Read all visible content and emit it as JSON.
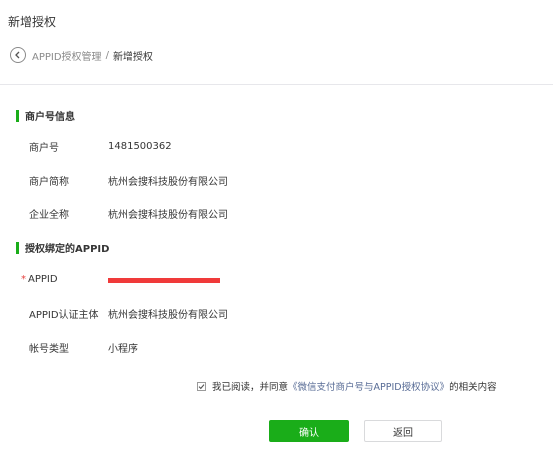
{
  "page": {
    "title": "新增授权"
  },
  "breadcrumb": {
    "back_icon": "chevron-left-icon",
    "parent": "APPID授权管理",
    "separator": "/",
    "current": "新增授权"
  },
  "merchant_section": {
    "heading": "商户号信息",
    "rows": [
      {
        "label": "商户号",
        "value": "1481500362"
      },
      {
        "label": "商户简称",
        "value": "杭州会搜科技股份有限公司"
      },
      {
        "label": "企业全称",
        "value": "杭州会搜科技股份有限公司"
      }
    ]
  },
  "appid_section": {
    "heading": "授权绑定的APPID",
    "appid_required_mark": "*",
    "appid_label": "APPID",
    "subject_label": "APPID认证主体",
    "subject_value": "杭州会搜科技股份有限公司",
    "type_label": "帐号类型",
    "type_value": "小程序"
  },
  "agreement": {
    "checked": true,
    "prefix": "我已阅读，并同意",
    "link": "《微信支付商户号与APPID授权协议》",
    "suffix": "的相关内容"
  },
  "buttons": {
    "confirm": "确认",
    "back": "返回"
  },
  "colors": {
    "accent_green": "#1aad19",
    "link_blue": "#576b95",
    "required_red": "#e64340",
    "redaction_red": "#f03a3a"
  }
}
